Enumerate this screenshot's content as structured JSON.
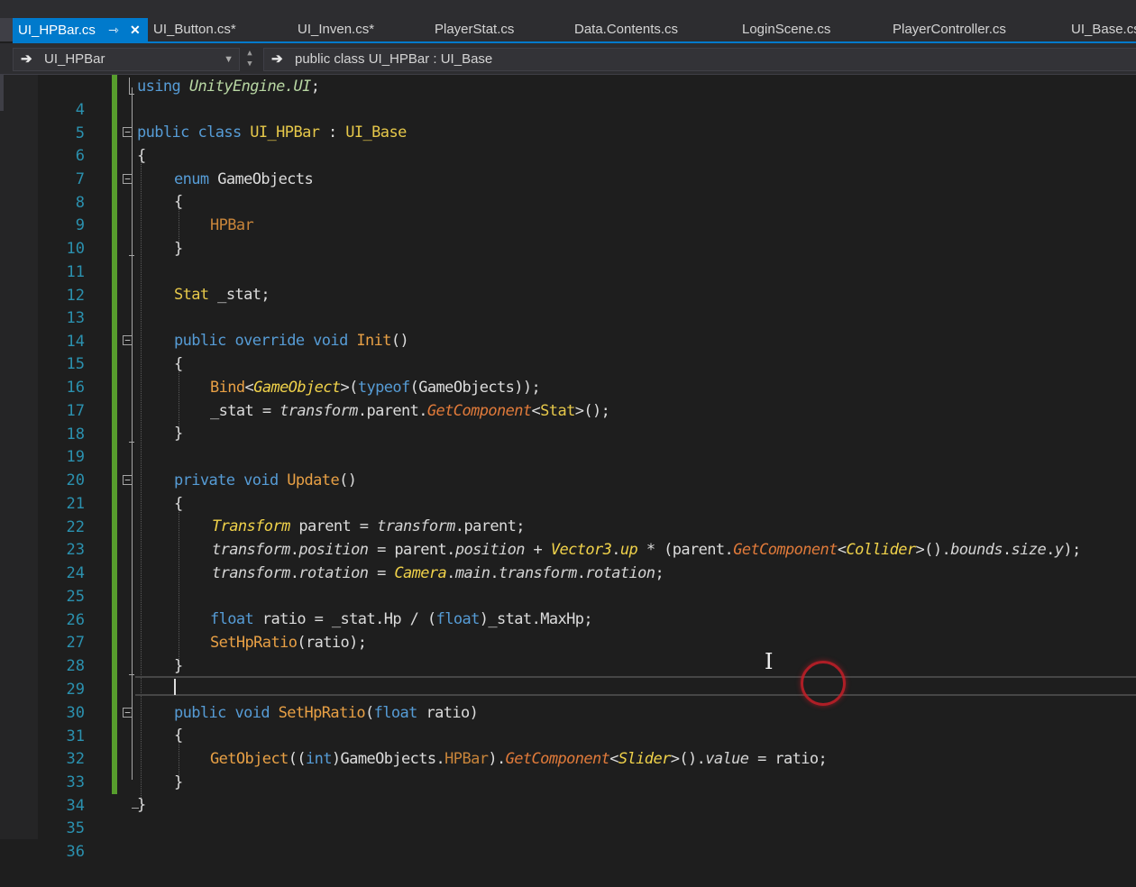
{
  "tabs": [
    {
      "label": "UI_HPBar.cs",
      "active": true,
      "pin_icon": "pin-icon",
      "close_icon": "close-icon"
    },
    {
      "label": "UI_Button.cs*"
    },
    {
      "label": "UI_Inven.cs*"
    },
    {
      "label": "PlayerStat.cs"
    },
    {
      "label": "Data.Contents.cs"
    },
    {
      "label": "LoginScene.cs"
    },
    {
      "label": "PlayerController.cs"
    },
    {
      "label": "UI_Base.cs"
    }
  ],
  "navbar": {
    "scope_dropdown": "UI_HPBar",
    "member_dropdown": "public class UI_HPBar : UI_Base"
  },
  "line_numbers": [
    "4",
    "5",
    "6",
    "7",
    "8",
    "9",
    "10",
    "11",
    "12",
    "13",
    "14",
    "15",
    "16",
    "17",
    "18",
    "19",
    "20",
    "21",
    "22",
    "23",
    "24",
    "25",
    "26",
    "27",
    "28",
    "29",
    "30",
    "31",
    "32",
    "33",
    "34",
    "35",
    "36"
  ],
  "code": {
    "l4": [
      "using",
      "UnityEngine.UI",
      ";"
    ],
    "l6": [
      "public class",
      "UI_HPBar",
      " : ",
      "UI_Base"
    ],
    "l7": [
      "{"
    ],
    "l8": [
      "enum",
      "GameObjects"
    ],
    "l9": [
      "{"
    ],
    "l10": [
      "HPBar"
    ],
    "l11": [
      "}"
    ],
    "l13": [
      "Stat",
      " _stat;"
    ],
    "l15": [
      "public override void",
      "Init",
      "()"
    ],
    "l16": [
      "{"
    ],
    "l17": [
      "Bind",
      "<",
      "GameObject",
      ">(",
      "typeof",
      "(",
      "GameObjects",
      "));"
    ],
    "l18": [
      "_stat",
      " = ",
      "transform",
      ".",
      "parent",
      ".",
      "GetComponent",
      "<",
      "Stat",
      ">();"
    ],
    "l19": [
      "}"
    ],
    "l21": [
      "private void",
      "Update",
      "()"
    ],
    "l22": [
      "{"
    ],
    "l23": [
      "Transform",
      " parent",
      " = ",
      "transform",
      ".",
      "parent",
      ";"
    ],
    "l24": [
      "transform",
      ".",
      "position",
      " = ",
      "parent",
      ".",
      "position",
      " + ",
      "Vector3",
      ".",
      "up",
      " * (",
      "parent",
      ".",
      "GetComponent",
      "<",
      "Collider",
      ">().",
      "bounds",
      ".",
      "size",
      ".",
      "y",
      ");"
    ],
    "l25": [
      "transform",
      ".",
      "rotation",
      " = ",
      "Camera",
      ".",
      "main",
      ".",
      "transform",
      ".",
      "rotation",
      ";"
    ],
    "l27": [
      "float",
      " ratio = ",
      "_stat",
      ".",
      "Hp",
      " / (",
      "float",
      ")",
      "_stat",
      ".",
      "MaxHp",
      ";"
    ],
    "l28": [
      "SetHpRatio",
      "(ratio);"
    ],
    "l29": [
      "}"
    ],
    "l31": [
      "public void",
      "SetHpRatio",
      "(",
      "float",
      " ratio)"
    ],
    "l32": [
      "{"
    ],
    "l33": [
      "GetObject",
      "((",
      "int",
      ")",
      "GameObjects",
      ".",
      "HPBar",
      ").",
      "GetComponent",
      "<",
      "Slider",
      ">().",
      "value",
      " = ratio;"
    ],
    "l34": [
      "}"
    ],
    "l35": [
      "}"
    ]
  },
  "colors": {
    "editor_bg": "#1e1e1e",
    "active_tab": "#007acc",
    "line_number": "#2b91af",
    "keyword": "#569cd6",
    "type": "#e6c84a",
    "change_bar": "#579d2d",
    "click_ring": "#c81e28"
  },
  "icons": {
    "nav_arrow": "arrow-right-icon",
    "dropdown": "chevron-down-icon",
    "fold": "collapse-icon",
    "cursor": "ibeam-cursor-icon"
  }
}
